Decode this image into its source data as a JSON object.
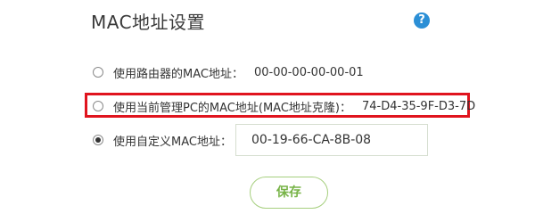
{
  "page": {
    "title": "MAC地址设置",
    "help_icon": "question-mark-icon",
    "help_glyph": "?"
  },
  "options": [
    {
      "label": "使用路由器的MAC地址：",
      "mac": "00-00-00-00-00-01",
      "selected": false
    },
    {
      "label": "使用当前管理PC的MAC地址(MAC地址克隆)：",
      "mac": "74-D4-35-9F-D3-7D",
      "selected": false,
      "highlighted": true
    },
    {
      "label": "使用自定义MAC地址：",
      "selected": true
    }
  ],
  "custom_mac": {
    "value": "00-19-66-CA-8B-08"
  },
  "actions": {
    "save_label": "保存"
  },
  "colors": {
    "highlight_border": "#e0141e",
    "help_icon_bg": "#2b8fd6",
    "save_text": "#77b347",
    "save_border": "#a6cf7e"
  }
}
